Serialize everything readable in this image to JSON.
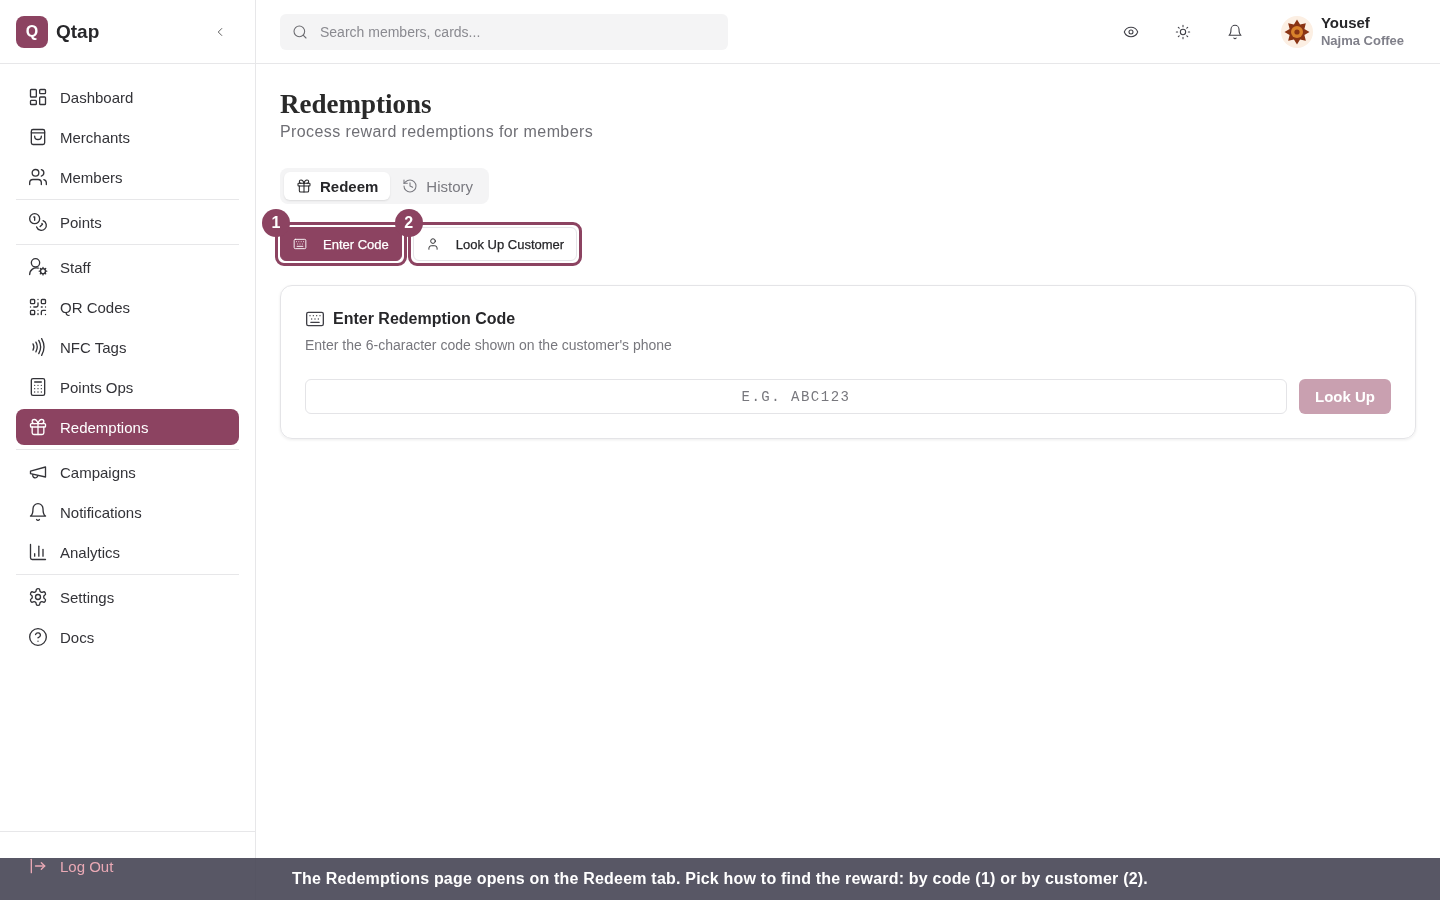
{
  "sidebar": {
    "brand": {
      "logo": "Q",
      "name": "Qtap"
    },
    "groups": [
      {
        "items": [
          {
            "label": "Dashboard",
            "selected": false
          },
          {
            "label": "Merchants",
            "selected": false
          },
          {
            "label": "Members",
            "selected": false
          }
        ]
      },
      {
        "items": [
          {
            "label": "Points",
            "selected": false
          }
        ]
      },
      {
        "items": [
          {
            "label": "Staff",
            "selected": false
          },
          {
            "label": "QR Codes",
            "selected": false
          },
          {
            "label": "NFC Tags",
            "selected": false
          },
          {
            "label": "Points Ops",
            "selected": false
          },
          {
            "label": "Redemptions",
            "selected": true
          }
        ]
      },
      {
        "items": [
          {
            "label": "Campaigns",
            "selected": false
          },
          {
            "label": "Notifications",
            "selected": false
          },
          {
            "label": "Analytics",
            "selected": false
          }
        ]
      },
      {
        "items": [
          {
            "label": "Settings",
            "selected": false
          },
          {
            "label": "Docs",
            "selected": false
          }
        ]
      }
    ],
    "footer": {
      "label": "Log Out"
    }
  },
  "header": {
    "search": {
      "placeholder": "Search members, cards..."
    },
    "user": {
      "name": "Yousef",
      "business": "Najma Coffee"
    }
  },
  "page": {
    "title": "Redemptions",
    "subtitle": "Process reward redemptions for members"
  },
  "tabs": [
    {
      "label": "Redeem",
      "selected": true
    },
    {
      "label": "History",
      "selected": false
    }
  ],
  "modes": [
    {
      "label": "Enter Code",
      "selected": true,
      "step": "1"
    },
    {
      "label": "Look Up Customer",
      "selected": false,
      "step": "2"
    }
  ],
  "card": {
    "title": "Enter Redemption Code",
    "description": "Enter the 6-character code shown on the customer's phone",
    "input": {
      "placeholder": "E.G. ABC123"
    },
    "button": {
      "label": "Look Up",
      "disabled": true
    }
  },
  "caption": "The Redemptions page opens on the Redeem tab. Pick how to find the reward: by code (1) or by customer (2)."
}
